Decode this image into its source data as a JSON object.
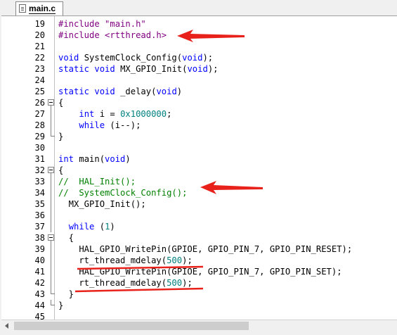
{
  "tabs": [
    {
      "label": "main.c",
      "active": true
    }
  ],
  "colors": {
    "keyword": "#0000ff",
    "preprocessor": "#800080",
    "number": "#008080",
    "comment": "#008000",
    "annotation": "#e8221b"
  },
  "lines": [
    {
      "n": "19",
      "fold": "",
      "tokens": [
        {
          "c": "pp",
          "t": "#include "
        },
        {
          "c": "str",
          "t": "\"main.h\""
        }
      ]
    },
    {
      "n": "20",
      "fold": "",
      "tokens": [
        {
          "c": "pp",
          "t": "#include "
        },
        {
          "c": "str",
          "t": "<rtthread.h>"
        }
      ]
    },
    {
      "n": "21",
      "fold": "",
      "tokens": []
    },
    {
      "n": "22",
      "fold": "",
      "tokens": [
        {
          "c": "kw",
          "t": "void"
        },
        {
          "c": "tx",
          "t": " SystemClock_Config("
        },
        {
          "c": "kw",
          "t": "void"
        },
        {
          "c": "tx",
          "t": ");"
        }
      ]
    },
    {
      "n": "23",
      "fold": "",
      "tokens": [
        {
          "c": "kw",
          "t": "static"
        },
        {
          "c": "tx",
          "t": " "
        },
        {
          "c": "kw",
          "t": "void"
        },
        {
          "c": "tx",
          "t": " MX_GPIO_Init("
        },
        {
          "c": "kw",
          "t": "void"
        },
        {
          "c": "tx",
          "t": ");"
        }
      ]
    },
    {
      "n": "24",
      "fold": "",
      "tokens": []
    },
    {
      "n": "25",
      "fold": "",
      "tokens": [
        {
          "c": "kw",
          "t": "static"
        },
        {
          "c": "tx",
          "t": " "
        },
        {
          "c": "kw",
          "t": "void"
        },
        {
          "c": "tx",
          "t": " _delay("
        },
        {
          "c": "kw",
          "t": "void"
        },
        {
          "c": "tx",
          "t": ")"
        }
      ]
    },
    {
      "n": "26",
      "fold": "start",
      "tokens": [
        {
          "c": "tx",
          "t": "{"
        }
      ]
    },
    {
      "n": "27",
      "fold": "line",
      "tokens": [
        {
          "c": "tx",
          "t": "    "
        },
        {
          "c": "kw",
          "t": "int"
        },
        {
          "c": "tx",
          "t": " i = "
        },
        {
          "c": "num",
          "t": "0x1000000"
        },
        {
          "c": "tx",
          "t": ";"
        }
      ]
    },
    {
      "n": "28",
      "fold": "line",
      "tokens": [
        {
          "c": "tx",
          "t": "    "
        },
        {
          "c": "kw",
          "t": "while"
        },
        {
          "c": "tx",
          "t": " (i--);"
        }
      ]
    },
    {
      "n": "29",
      "fold": "end",
      "tokens": [
        {
          "c": "tx",
          "t": "}"
        }
      ]
    },
    {
      "n": "30",
      "fold": "",
      "tokens": []
    },
    {
      "n": "31",
      "fold": "",
      "tokens": [
        {
          "c": "kw",
          "t": "int"
        },
        {
          "c": "tx",
          "t": " main("
        },
        {
          "c": "kw",
          "t": "void"
        },
        {
          "c": "tx",
          "t": ")"
        }
      ]
    },
    {
      "n": "32",
      "fold": "start",
      "tokens": [
        {
          "c": "tx",
          "t": "{"
        }
      ]
    },
    {
      "n": "33",
      "fold": "line",
      "tokens": [
        {
          "c": "cm",
          "t": "//  HAL_Init();"
        }
      ]
    },
    {
      "n": "34",
      "fold": "line",
      "tokens": [
        {
          "c": "cm",
          "t": "//  SystemClock_Config();"
        }
      ]
    },
    {
      "n": "35",
      "fold": "line",
      "tokens": [
        {
          "c": "tx",
          "t": "  MX_GPIO_Init();"
        }
      ]
    },
    {
      "n": "36",
      "fold": "line",
      "tokens": []
    },
    {
      "n": "37",
      "fold": "line",
      "tokens": [
        {
          "c": "tx",
          "t": "  "
        },
        {
          "c": "kw",
          "t": "while"
        },
        {
          "c": "tx",
          "t": " ("
        },
        {
          "c": "num",
          "t": "1"
        },
        {
          "c": "tx",
          "t": ")"
        }
      ]
    },
    {
      "n": "38",
      "fold": "start",
      "tokens": [
        {
          "c": "tx",
          "t": "  {"
        }
      ]
    },
    {
      "n": "39",
      "fold": "line",
      "tokens": [
        {
          "c": "tx",
          "t": "    HAL_GPIO_WritePin(GPIOE, GPIO_PIN_7, GPIO_PIN_RESET);"
        }
      ]
    },
    {
      "n": "40",
      "fold": "line",
      "tokens": [
        {
          "c": "tx",
          "t": "    rt_thread_mdelay("
        },
        {
          "c": "num",
          "t": "500"
        },
        {
          "c": "tx",
          "t": ");"
        }
      ]
    },
    {
      "n": "41",
      "fold": "line",
      "tokens": [
        {
          "c": "tx",
          "t": "    HAL_GPIO_WritePin(GPIOE, GPIO_PIN_7, GPIO_PIN_SET);"
        }
      ]
    },
    {
      "n": "42",
      "fold": "line",
      "tokens": [
        {
          "c": "tx",
          "t": "    rt_thread_mdelay("
        },
        {
          "c": "num",
          "t": "500"
        },
        {
          "c": "tx",
          "t": ");"
        }
      ]
    },
    {
      "n": "43",
      "fold": "end",
      "tokens": [
        {
          "c": "tx",
          "t": "  }"
        }
      ]
    },
    {
      "n": "44",
      "fold": "end",
      "tokens": [
        {
          "c": "tx",
          "t": "}"
        }
      ]
    },
    {
      "n": "45",
      "fold": "",
      "tokens": []
    }
  ]
}
